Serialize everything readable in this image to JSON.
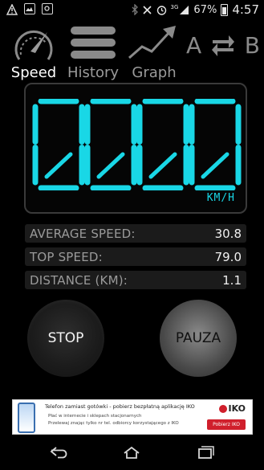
{
  "status_bar": {
    "signal_label": "3G",
    "battery_percent": "67%",
    "time": "4:57"
  },
  "nav": {
    "speed_label": "Speed",
    "history_label": "History",
    "graph_label": "Graph",
    "switch_letter_a": "A",
    "switch_letter_b": "B"
  },
  "speed": {
    "digits": [
      "0",
      "0",
      "0",
      "0"
    ],
    "unit": "KM/H",
    "color": "#19d7e6"
  },
  "stats": [
    {
      "label": "AVERAGE SPEED:",
      "value": "30.8"
    },
    {
      "label": "TOP SPEED:",
      "value": "79.0"
    },
    {
      "label": "DISTANCE (KM):",
      "value": "1.1"
    }
  ],
  "buttons": {
    "stop_label": "STOP",
    "pause_label": "PAUZA"
  },
  "ad": {
    "headline": "Telefon zamiast gotówki - pobierz bezpłatną aplikację IKO",
    "bullet1": "Płać w internecie i sklepach stacjonarnych",
    "bullet2": "Przelewaj znając tylko nr tel. odbiorcy korzystającego z IKO",
    "brand": "IKO",
    "cta": "Pobierz IKO",
    "brand_color": "#d01f2c"
  }
}
